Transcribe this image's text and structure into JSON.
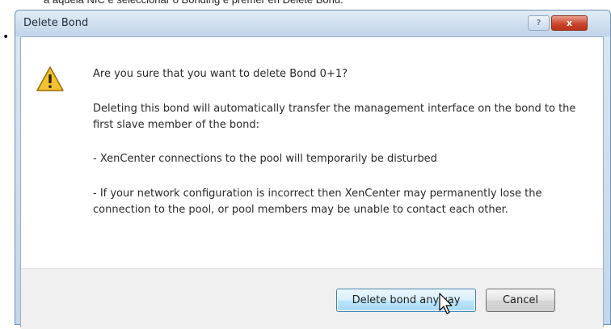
{
  "page": {
    "top_text": "a aquela NIC e seleccionar o Bonding e premer en Delete Bond."
  },
  "dialog": {
    "title": "Delete Bond",
    "help_label": "?",
    "close_label": "x",
    "question": "Are you sure that you want to delete Bond 0+1?",
    "paragraph_1": "Deleting this bond will automatically transfer the management interface on the bond to the first slave member of the bond:",
    "paragraph_2": "- XenCenter connections to the pool will temporarily be disturbed",
    "paragraph_3": "- If your network configuration is incorrect then XenCenter may permanently lose the connection to the pool, or pool members may be unable to contact each other.",
    "buttons": {
      "confirm": "Delete bond anyway",
      "cancel": "Cancel"
    },
    "icons": {
      "warning": "warning-icon",
      "cursor": "mouse-cursor-icon"
    }
  },
  "colors": {
    "title_bar": "#c9dbee",
    "close_button": "#c9462c",
    "default_button_border": "#3c7fb1",
    "warning_yellow": "#f2c230"
  }
}
